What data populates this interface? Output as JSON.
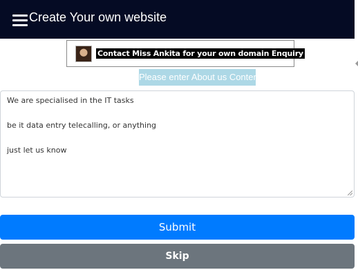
{
  "header": {
    "menu_icon": "hamburger-menu-icon",
    "title": "Create Your own website",
    "background": "#050b24"
  },
  "banner": {
    "text": "Contact Miss Ankita for your own domain Enquiry"
  },
  "about_prompt": {
    "text": "Please enter About us Content",
    "background": "#add8e6"
  },
  "content": {
    "lines": [
      "We are specialised in the IT tasks",
      "be it data entry telecalling, or anything",
      "just let us know"
    ]
  },
  "buttons": {
    "submit_label": "Submit",
    "submit_color": "#007bff",
    "skip_label": "Skip",
    "skip_color": "#6c757d"
  }
}
